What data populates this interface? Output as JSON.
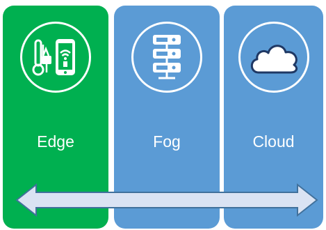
{
  "colors": {
    "edge": "#00B050",
    "fog": "#5B9BD5",
    "cloud": "#5B9BD5",
    "arrow_fill": "#DAE3F3",
    "arrow_stroke": "#41719C"
  },
  "panels": [
    {
      "id": "edge",
      "label": "Edge",
      "icon": "sensor-phone-icon"
    },
    {
      "id": "fog",
      "label": "Fog",
      "icon": "server-rack-icon"
    },
    {
      "id": "cloud",
      "label": "Cloud",
      "icon": "cloud-icon"
    }
  ],
  "arrow": {
    "icon": "double-headed-arrow-icon"
  }
}
